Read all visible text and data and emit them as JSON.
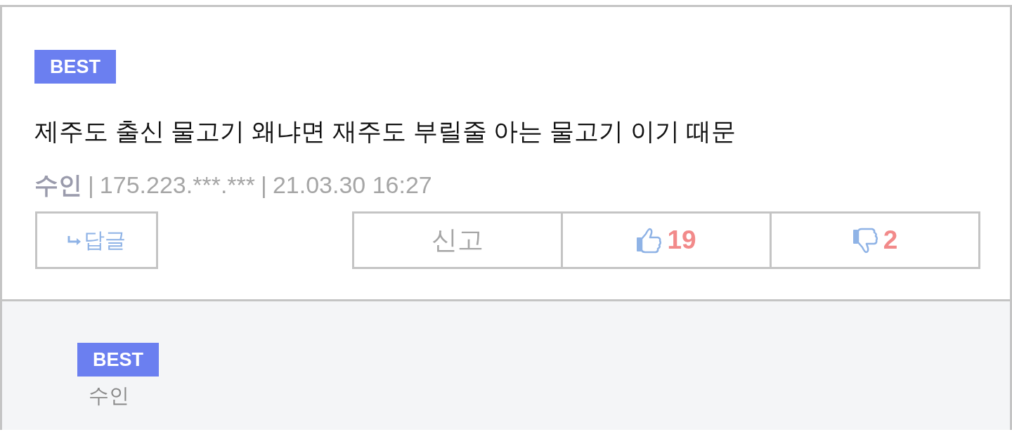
{
  "comments": [
    {
      "badge": "BEST",
      "text": "제주도 출신 물고기 왜냐면 재주도 부릴줄 아는 물고기 이기 때문",
      "author": "수인",
      "separator": "|",
      "ip": "175.223.***.***",
      "date": "21.03.30 16:27",
      "reply_label": "답글",
      "report_label": "신고",
      "likes": "19",
      "dislikes": "2"
    },
    {
      "badge": "BEST",
      "author": "수인"
    }
  ]
}
